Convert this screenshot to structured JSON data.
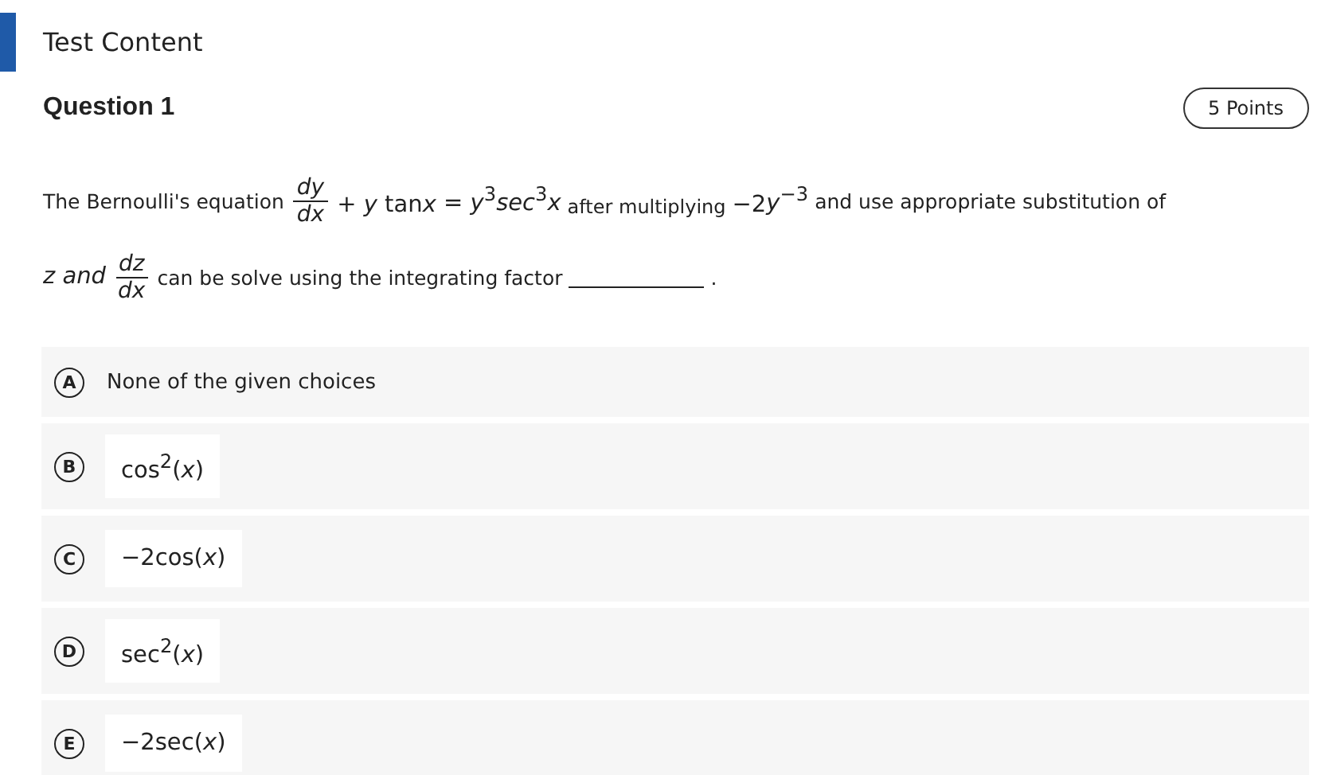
{
  "header": {
    "title": "Test Content"
  },
  "question": {
    "title": "Question 1",
    "points": "5 Points",
    "lines": [
      [
        {
          "kind": "text",
          "text": "The Bernoulli's equation"
        },
        {
          "kind": "frac",
          "num": "dy",
          "den": "dx"
        },
        {
          "kind": "math",
          "pieces": [
            "+ *y* tan",
            "*x*",
            " = *y*$^{3}$*sec*$^{3}$*x*"
          ]
        },
        {
          "kind": "small",
          "text": "after multiplying"
        },
        {
          "kind": "math",
          "pieces": [
            "−2",
            "*y*$^{−3}$"
          ]
        },
        {
          "kind": "text",
          "text": "and use appropriate substitution of"
        }
      ],
      [
        {
          "kind": "math",
          "pieces": [
            "*z and*"
          ]
        },
        {
          "kind": "frac",
          "num": "dz",
          "den": "dx"
        },
        {
          "kind": "text",
          "text": "can be solve using the integrating factor"
        },
        {
          "kind": "blank"
        },
        {
          "kind": "text",
          "text": "."
        }
      ]
    ]
  },
  "options": [
    {
      "letter": "A",
      "kind": "text",
      "text": "None of the given choices"
    },
    {
      "letter": "B",
      "kind": "math",
      "text": "cos$^{2}$(*x*)"
    },
    {
      "letter": "C",
      "kind": "math",
      "text": "−2cos(*x*)"
    },
    {
      "letter": "D",
      "kind": "math",
      "text": "sec$^{2}$(*x*)"
    },
    {
      "letter": "E",
      "kind": "math",
      "text": "−2sec(*x*)"
    }
  ]
}
